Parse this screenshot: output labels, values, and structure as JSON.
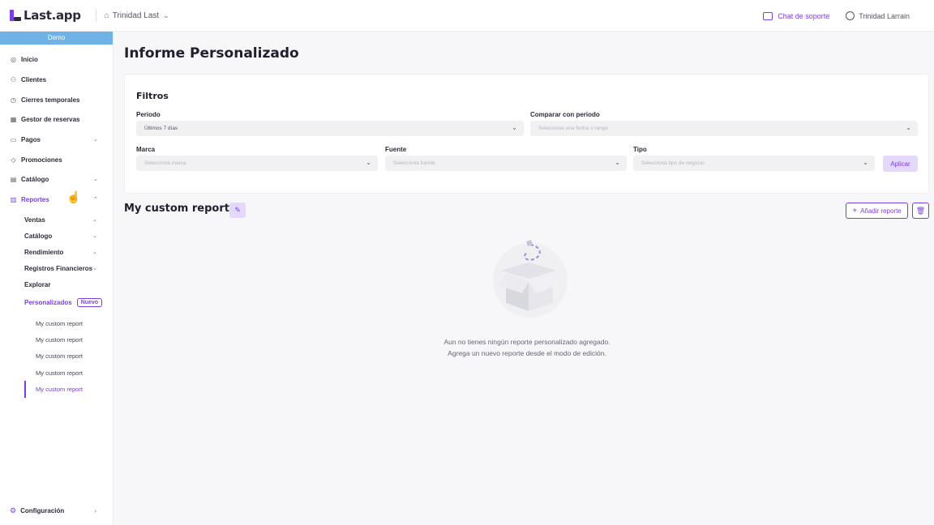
{
  "header": {
    "logo_text": "Last.app",
    "store_name": "Trinidad Last",
    "support_label": "Chat de soporte",
    "user_name": "Trinidad Larrain"
  },
  "sidebar": {
    "demo_label": "Demo",
    "items": [
      {
        "label": "Inicio",
        "icon": "location-pin-icon"
      },
      {
        "label": "Clientes",
        "icon": "users-icon"
      },
      {
        "label": "Cierres temporales",
        "icon": "clock-icon"
      },
      {
        "label": "Gestor de reservas",
        "icon": "calendar-icon"
      },
      {
        "label": "Pagos",
        "icon": "card-icon"
      },
      {
        "label": "Promociones",
        "icon": "tag-icon"
      },
      {
        "label": "Catálogo",
        "icon": "book-icon"
      },
      {
        "label": "Reportes",
        "icon": "chart-icon"
      }
    ],
    "sub_items": [
      {
        "label": "Ventas"
      },
      {
        "label": "Catálogo"
      },
      {
        "label": "Rendimiento"
      },
      {
        "label": "Registros Financieros"
      },
      {
        "label": "Explorar"
      },
      {
        "label": "Personalizados",
        "badge": "Nuevo"
      }
    ],
    "reports": [
      "My custom report",
      "My custom report",
      "My custom report",
      "My custom report",
      "My custom report"
    ],
    "config_label": "Configuración"
  },
  "main": {
    "title": "Informe Personalizado",
    "filters": {
      "title": "Filtros",
      "period_label": "Periodo",
      "period_value": "Últimos 7 días",
      "compare_label": "Comparar con periodo",
      "compare_placeholder": "Selecciona una fecha o rango",
      "brand_label": "Marca",
      "brand_placeholder": "Selecciona marca",
      "source_label": "Fuente",
      "source_placeholder": "Selecciona fuente",
      "type_label": "Tipo",
      "type_placeholder": "Selecciona tipo de negocio",
      "apply_label": "Aplicar"
    },
    "report": {
      "title": "My custom report",
      "add_label": "Añadir reporte",
      "empty_line1": "Aun no tienes ningún reporte personalizado agregado.",
      "empty_line2": "Agrega un nuevo reporte desde el modo de edición."
    }
  },
  "colors": {
    "accent": "#7a3fe0",
    "demo_banner": "#6fb3e6",
    "accent_light": "#e4d9fb"
  }
}
